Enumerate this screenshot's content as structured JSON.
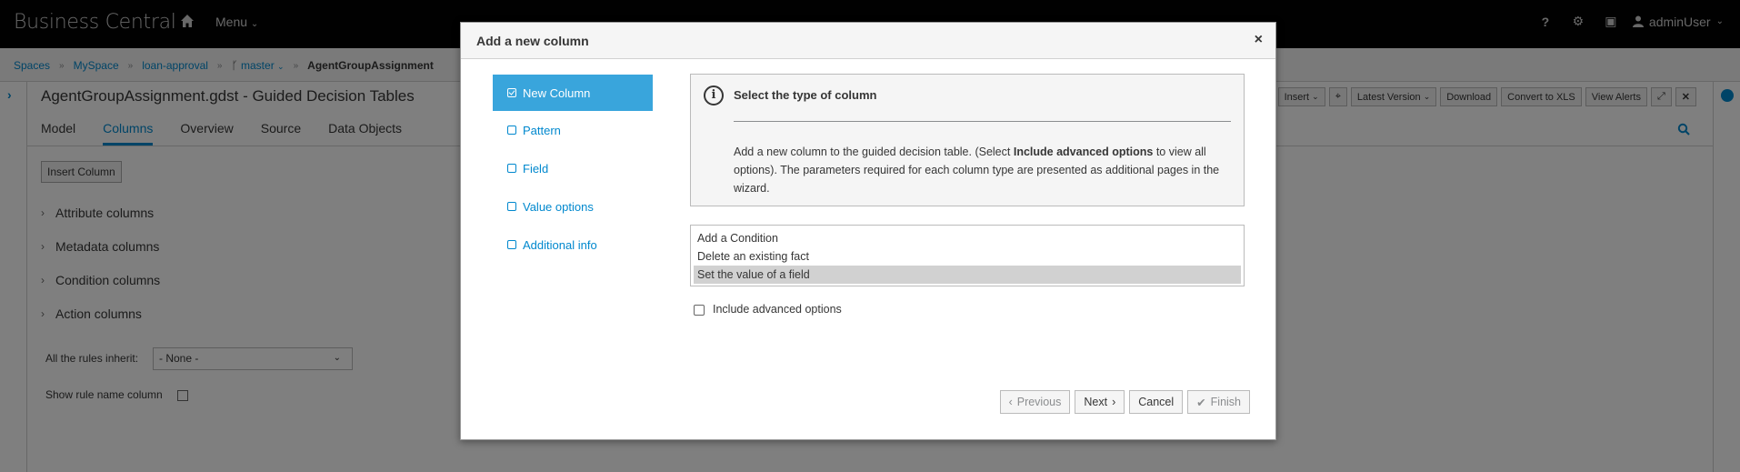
{
  "navbar": {
    "brand": "Business Central",
    "menu_label": "Menu",
    "user_label": "adminUser"
  },
  "breadcrumb": {
    "items": [
      "Spaces",
      "MySpace",
      "loan-approval",
      "master",
      "AgentGroupAssignment"
    ]
  },
  "editor": {
    "title": "AgentGroupAssignment.gdst - Guided Decision Tables",
    "toolbar": {
      "insert_label": "Insert",
      "latest_version_label": "Latest Version",
      "download_label": "Download",
      "convert_label": "Convert to XLS",
      "alerts_label": "View Alerts"
    },
    "tabs": [
      "Model",
      "Columns",
      "Overview",
      "Source",
      "Data Objects"
    ],
    "active_tab": "Columns",
    "insert_column_label": "Insert Column",
    "sections": [
      "Attribute columns",
      "Metadata columns",
      "Condition columns",
      "Action columns"
    ],
    "inherit_label": "All the rules inherit:",
    "inherit_value": "- None -",
    "rule_name_label": "Show rule name column"
  },
  "modal": {
    "title": "Add a new column",
    "close_glyph": "×",
    "steps": [
      "New Column",
      "Pattern",
      "Field",
      "Value options",
      "Additional info"
    ],
    "active_step": "New Column",
    "info": {
      "title": "Select the type of column",
      "text_before": "Add a new column to the guided decision table. (Select ",
      "text_bold": "Include advanced options",
      "text_after": " to view all options). The parameters required for each column type are presented as additional pages in the wizard."
    },
    "options": [
      "Add a Condition",
      "Delete an existing fact",
      "Set the value of a field"
    ],
    "selected_option": "Set the value of a field",
    "advanced_label": "Include advanced options",
    "buttons": {
      "previous": "Previous",
      "next": "Next",
      "cancel": "Cancel",
      "finish": "Finish"
    }
  }
}
